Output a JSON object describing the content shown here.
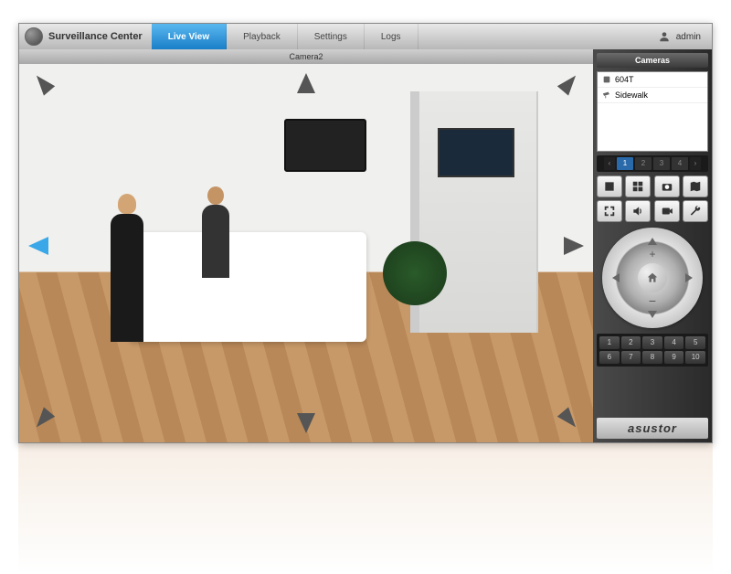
{
  "app": {
    "title": "Surveillance Center"
  },
  "tabs": {
    "liveView": "Live View",
    "playback": "Playback",
    "settings": "Settings",
    "logs": "Logs"
  },
  "user": {
    "name": "admin"
  },
  "video": {
    "cameraTitle": "Camera2"
  },
  "sidebar": {
    "camerasTitle": "Cameras",
    "items": [
      {
        "label": "604T"
      },
      {
        "label": "Sidewalk"
      }
    ],
    "layouts": [
      "1",
      "2",
      "3",
      "4"
    ],
    "presets": [
      "1",
      "2",
      "3",
      "4",
      "5",
      "6",
      "7",
      "8",
      "9",
      "10"
    ],
    "brand": "asustor"
  }
}
